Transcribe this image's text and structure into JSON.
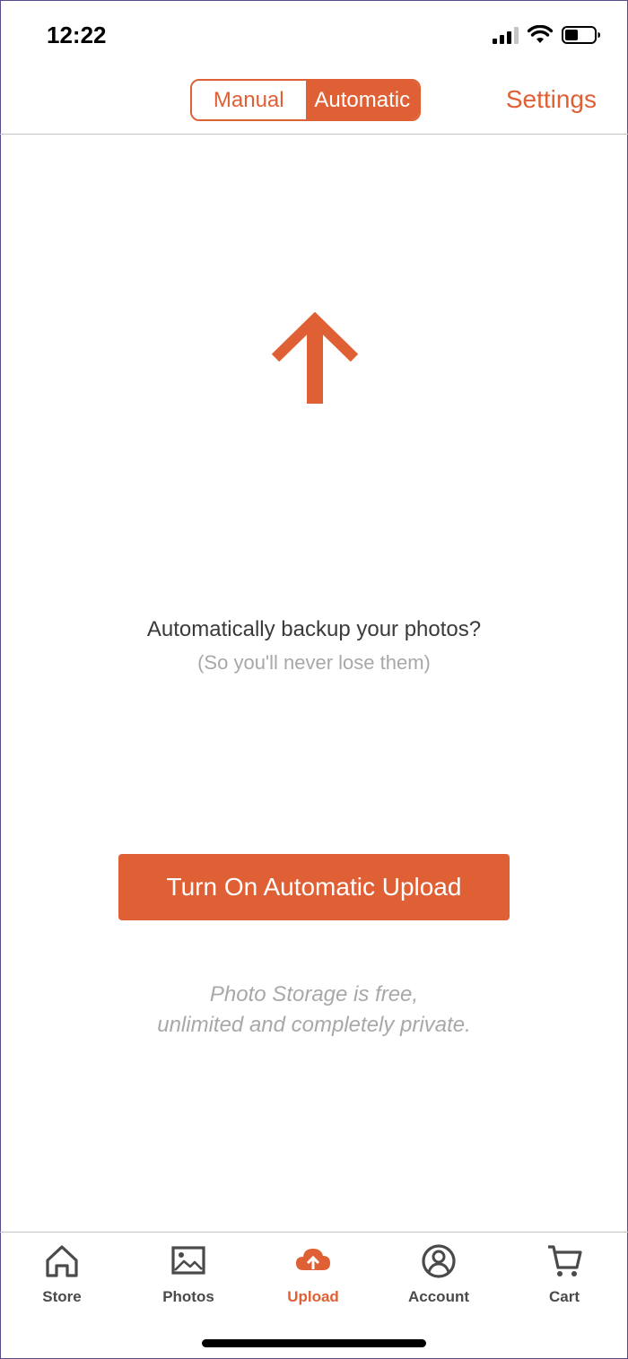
{
  "status_bar": {
    "time": "12:22",
    "icons": [
      "cellular-signal-icon",
      "wifi-icon",
      "battery-icon"
    ]
  },
  "header": {
    "segments": [
      {
        "label": "Manual",
        "selected": false
      },
      {
        "label": "Automatic",
        "selected": true
      }
    ],
    "settings_label": "Settings"
  },
  "main": {
    "icon": "upload-arrow-icon",
    "prompt": "Automatically backup your photos?",
    "sub_prompt": "(So you'll never lose them)",
    "cta_label": "Turn On Automatic Upload",
    "note_line1": "Photo Storage is free,",
    "note_line2": "unlimited and completely private."
  },
  "tabbar": {
    "tabs": [
      {
        "label": "Store",
        "icon": "home-icon",
        "active": false
      },
      {
        "label": "Photos",
        "icon": "photo-icon",
        "active": false
      },
      {
        "label": "Upload",
        "icon": "cloud-upload-icon",
        "active": true
      },
      {
        "label": "Account",
        "icon": "account-icon",
        "active": false
      },
      {
        "label": "Cart",
        "icon": "cart-icon",
        "active": false
      }
    ]
  },
  "colors": {
    "accent": "#e06035",
    "muted_text": "#a8a8a8",
    "tab_text": "#4a4a4a"
  }
}
